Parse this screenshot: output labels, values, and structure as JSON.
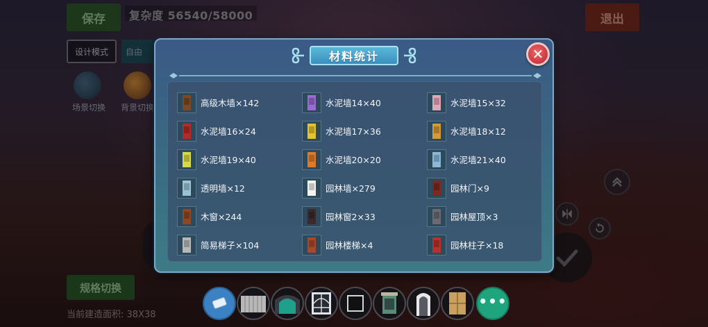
{
  "background": {
    "save_label": "保存",
    "complexity": "复杂度 56540/58000",
    "exit_label": "退出",
    "design_mode_label": "设计模式",
    "free_mode_label": "自由",
    "scene_switch_label": "场景切换",
    "bg_switch_label": "背景切换",
    "spec_switch_label": "规格切换",
    "build_area": "当前建造面积: 38X38"
  },
  "modal": {
    "title": "材料统计",
    "close_label": "✕",
    "items": [
      {
        "label": "高级木墙×142",
        "icon": "wood-wall-icon",
        "color": "#7a4a28"
      },
      {
        "label": "水泥墙14×40",
        "icon": "cement-wall-purple-icon",
        "color": "#9a6ad0"
      },
      {
        "label": "水泥墙15×32",
        "icon": "cement-wall-pink-icon",
        "color": "#e2a6b6"
      },
      {
        "label": "水泥墙16×24",
        "icon": "cement-wall-red-icon",
        "color": "#b22a2a"
      },
      {
        "label": "水泥墙17×36",
        "icon": "cement-wall-yellow-icon",
        "color": "#e6c22e"
      },
      {
        "label": "水泥墙18×12",
        "icon": "cement-wall-ochre-icon",
        "color": "#d49a3a"
      },
      {
        "label": "水泥墙19×40",
        "icon": "cement-wall-lime-icon",
        "color": "#d8d84a"
      },
      {
        "label": "水泥墙20×20",
        "icon": "cement-wall-orange-icon",
        "color": "#e07a2a"
      },
      {
        "label": "水泥墙21×40",
        "icon": "cement-wall-blue-icon",
        "color": "#8ab8d8"
      },
      {
        "label": "透明墙×12",
        "icon": "glass-wall-icon",
        "color": "#9ac4d4"
      },
      {
        "label": "园林墙×279",
        "icon": "garden-wall-icon",
        "color": "#f4f4f4"
      },
      {
        "label": "园林门×9",
        "icon": "garden-door-icon",
        "color": "#7a2a22"
      },
      {
        "label": "木窗×244",
        "icon": "wood-window-icon",
        "color": "#8a4a2a"
      },
      {
        "label": "园林窗2×33",
        "icon": "garden-window-icon",
        "color": "#3a2a2e"
      },
      {
        "label": "园林屋顶×3",
        "icon": "garden-roof-icon",
        "color": "#6a6a74"
      },
      {
        "label": "简易梯子×104",
        "icon": "ladder-icon",
        "color": "#b8b8b8"
      },
      {
        "label": "园林楼梯×4",
        "icon": "garden-stairs-icon",
        "color": "#a8482a"
      },
      {
        "label": "园林柱子×18",
        "icon": "garden-pillar-icon",
        "color": "#b83030"
      }
    ]
  },
  "toolbar": [
    {
      "name": "eraser-tool",
      "icon": "eraser-icon"
    },
    {
      "name": "fence-tool",
      "icon": "fence-icon"
    },
    {
      "name": "arch-gate-tool",
      "icon": "arch-gate-icon"
    },
    {
      "name": "lattice-window-tool",
      "icon": "lattice-window-icon"
    },
    {
      "name": "dark-window-tool",
      "icon": "dark-window-icon"
    },
    {
      "name": "garden-window-tool",
      "icon": "garden-window-icon"
    },
    {
      "name": "garden-door-tool",
      "icon": "garden-door-icon"
    },
    {
      "name": "wood-panel-tool",
      "icon": "wood-panel-icon"
    },
    {
      "name": "more-button",
      "icon": "more-icon",
      "label": "•••"
    }
  ]
}
